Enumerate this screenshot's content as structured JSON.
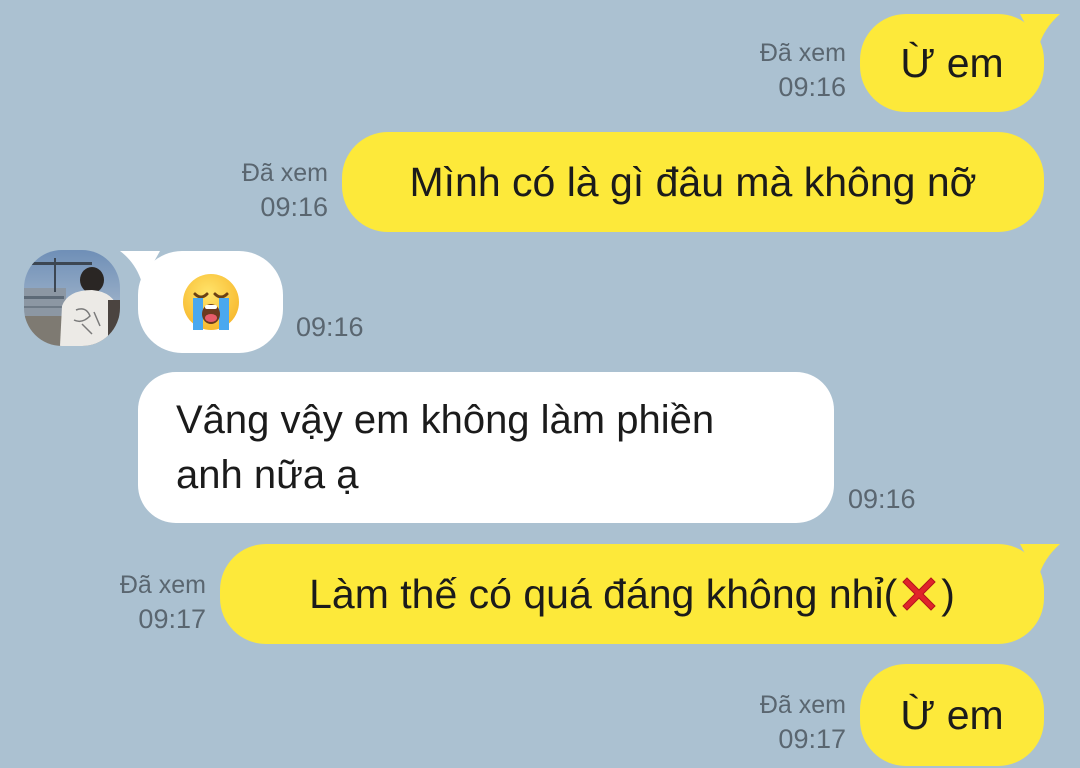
{
  "messages": [
    {
      "direction": "sent",
      "text": "Ừ em",
      "status": "Đã xem",
      "time": "09:16"
    },
    {
      "direction": "sent",
      "text": "Mình có là gì đâu mà không nỡ",
      "status": "Đã xem",
      "time": "09:16"
    },
    {
      "direction": "received",
      "emoji": "loudly-crying-face",
      "time": "09:16"
    },
    {
      "direction": "received",
      "line1": "Vâng vậy em không làm phiền",
      "line2": "anh nữa ạ",
      "time": "09:16"
    },
    {
      "direction": "sent",
      "text": "Làm thế có quá đáng không nhỉ(",
      "text_suffix": ")",
      "emoji": "cross-mark",
      "status": "Đã xem",
      "time": "09:17"
    },
    {
      "direction": "sent",
      "text": "Ừ em",
      "status": "Đã xem",
      "time": "09:17"
    }
  ],
  "colors": {
    "background": "#abc1d1",
    "sent_bubble": "#fde93a",
    "received_bubble": "#ffffff",
    "meta_text": "#5a6670"
  }
}
